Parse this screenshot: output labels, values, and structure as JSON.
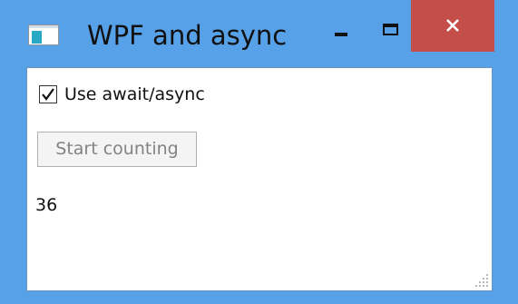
{
  "window": {
    "title": "WPF and async",
    "icon": "app-window-icon",
    "controls": {
      "minimize_icon": "minimize-icon",
      "maximize_icon": "maximize-icon",
      "close_icon": "close-icon",
      "close_color": "#c44f4a"
    },
    "frame_color": "#57a1e8"
  },
  "content": {
    "checkbox": {
      "label": "Use await/async",
      "checked": true
    },
    "start_button": {
      "label": "Start counting",
      "enabled": false
    },
    "counter_value": "36"
  }
}
